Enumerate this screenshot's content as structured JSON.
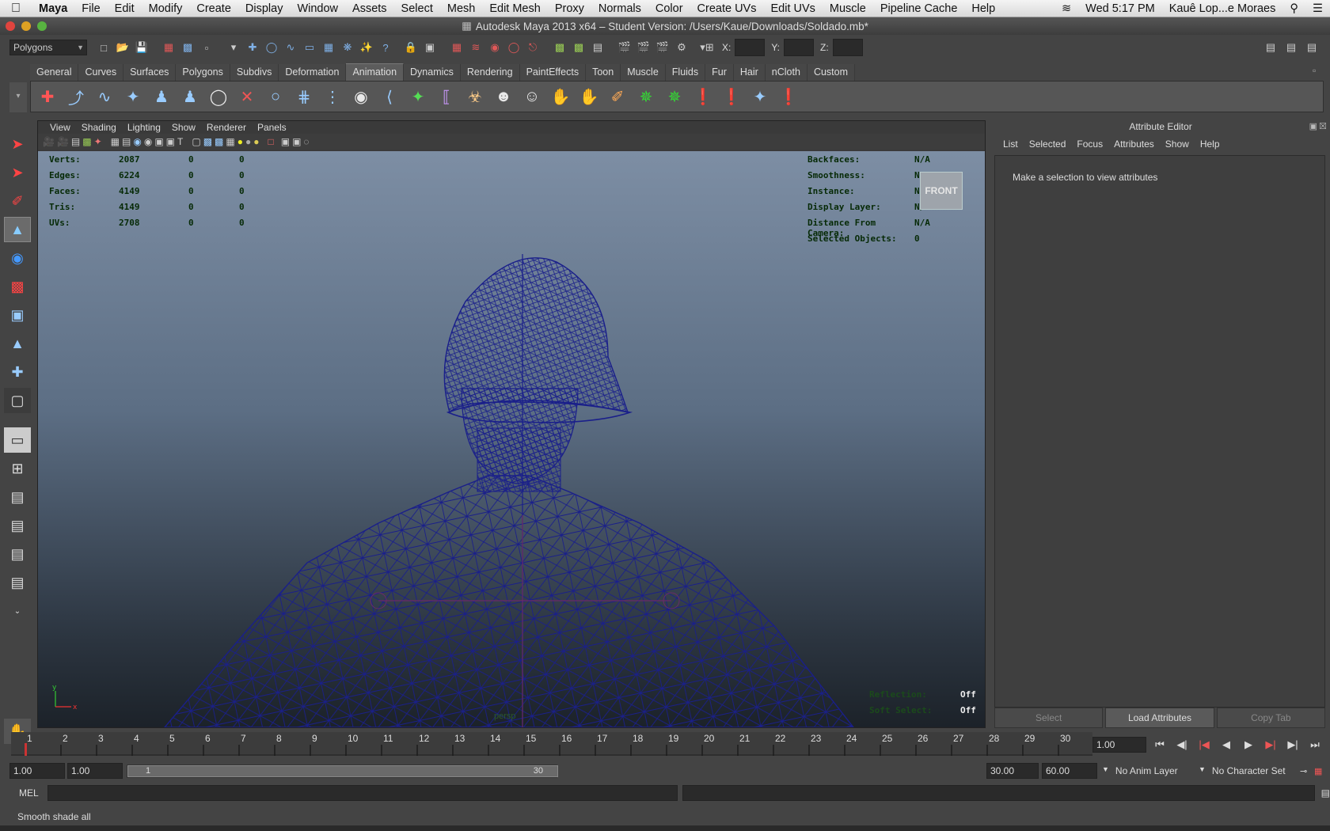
{
  "macbar": {
    "app": "Maya",
    "menus": [
      "File",
      "Edit",
      "Modify",
      "Create",
      "Display",
      "Window",
      "Assets",
      "Select",
      "Mesh",
      "Edit Mesh",
      "Proxy",
      "Normals",
      "Color",
      "Create UVs",
      "Edit UVs",
      "Muscle",
      "Pipeline Cache",
      "Help"
    ],
    "clock": "Wed 5:17 PM",
    "user": "Kauê Lop...e Moraes"
  },
  "window": {
    "title": "Autodesk Maya 2013 x64 – Student Version: /Users/Kaue/Downloads/Soldado.mb*"
  },
  "statusline": {
    "menuset": "Polygons",
    "x_label": "X:",
    "y_label": "Y:",
    "z_label": "Z:"
  },
  "shelf": {
    "tabs": [
      "General",
      "Curves",
      "Surfaces",
      "Polygons",
      "Subdivs",
      "Deformation",
      "Animation",
      "Dynamics",
      "Rendering",
      "PaintEffects",
      "Toon",
      "Muscle",
      "Fluids",
      "Fur",
      "Hair",
      "nCloth",
      "Custom"
    ],
    "active_tab": "Animation"
  },
  "viewport": {
    "menus": [
      "View",
      "Shading",
      "Lighting",
      "Show",
      "Renderer",
      "Panels"
    ],
    "hud_left": [
      {
        "k": "Verts:",
        "v": "2087",
        "a": "0",
        "b": "0"
      },
      {
        "k": "Edges:",
        "v": "6224",
        "a": "0",
        "b": "0"
      },
      {
        "k": "Faces:",
        "v": "4149",
        "a": "0",
        "b": "0"
      },
      {
        "k": "Tris:",
        "v": "4149",
        "a": "0",
        "b": "0"
      },
      {
        "k": "UVs:",
        "v": "2708",
        "a": "0",
        "b": "0"
      }
    ],
    "hud_right": [
      {
        "k": "Backfaces:",
        "v": "N/A"
      },
      {
        "k": "Smoothness:",
        "v": "N/A"
      },
      {
        "k": "Instance:",
        "v": "N/A"
      },
      {
        "k": "Display Layer:",
        "v": "N/A"
      },
      {
        "k": "Distance From Camera:",
        "v": "N/A"
      },
      {
        "k": "Selected Objects:",
        "v": "0"
      }
    ],
    "viewcube": "FRONT",
    "camera": "persp",
    "hud_bottom": [
      {
        "k": "Reflection:",
        "v": "Off"
      },
      {
        "k": "Soft Select:",
        "v": "Off"
      }
    ]
  },
  "attribute_editor": {
    "title": "Attribute Editor",
    "menus": [
      "List",
      "Selected",
      "Focus",
      "Attributes",
      "Show",
      "Help"
    ],
    "message": "Make a selection to view attributes",
    "buttons": [
      "Select",
      "Load Attributes",
      "Copy Tab"
    ]
  },
  "timeslider": {
    "frames": [
      "1",
      "2",
      "3",
      "4",
      "5",
      "6",
      "7",
      "8",
      "9",
      "10",
      "11",
      "12",
      "13",
      "14",
      "15",
      "16",
      "17",
      "18",
      "19",
      "20",
      "21",
      "22",
      "23",
      "24",
      "25",
      "26",
      "27",
      "28",
      "29",
      "30"
    ],
    "current": "1.00"
  },
  "range": {
    "start": "1.00",
    "playback_start": "1.00",
    "slider_start": "1",
    "slider_end": "30",
    "playback_end": "30.00",
    "end": "60.00",
    "anim_layer": "No Anim Layer",
    "char_set": "No Character Set"
  },
  "mel": {
    "label": "MEL"
  },
  "helpline": {
    "text": "Smooth shade all"
  }
}
